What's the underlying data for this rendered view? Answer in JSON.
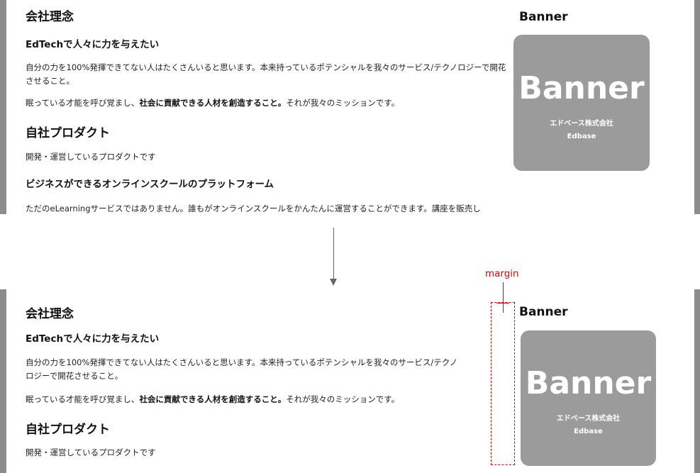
{
  "before": {
    "company_philosophy_heading": "会社理念",
    "edtech_heading": "EdTechで人々に力を与えたい",
    "paragraph1": "自分の力を100%発揮できてない人はたくさんいると思います。本来持っているポテンシャルを我々のサービス/テクノロジーで開花させること。",
    "paragraph2_pre": "眠っている才能を呼び覚まし、",
    "paragraph2_bold": "社会に貢献できる人材を創造すること。",
    "paragraph2_post": "それが我々のミッションです。",
    "product_heading": "自社プロダクト",
    "product_desc": "開発・運営しているプロダクトです",
    "platform_heading": "ビジネスができるオンラインスクールのプラットフォーム",
    "platform_desc": "ただのeLearningサービスではありません。誰もがオンラインスクールをかんたんに運営することができます。講座を販売し"
  },
  "after": {
    "company_philosophy_heading": "会社理念",
    "edtech_heading": "EdTechで人々に力を与えたい",
    "paragraph1_line1": "自分の力を100%発揮できてない人はたくさんいると思います。本来持っているポテンシャルを我々のサービス/テクノ",
    "paragraph1_line2": "ロジーで開花させること。",
    "paragraph2_pre": "眠っている才能を呼び覚まし、",
    "paragraph2_bold": "社会に貢献できる人材を創造すること。",
    "paragraph2_post": "それが我々のミッションです。",
    "product_heading": "自社プロダクト",
    "product_desc": "開発・運営しているプロダクトです"
  },
  "banner": {
    "title": "Banner",
    "big_text": "Banner",
    "company_jp": "エドベース株式会社",
    "company_en": "Edbase"
  },
  "annotation": {
    "margin_label": "margin"
  },
  "colors": {
    "banner_bg": "#9b9b9b",
    "annotation_red": "#e00000",
    "edge_gray": "#8c8c8c"
  }
}
